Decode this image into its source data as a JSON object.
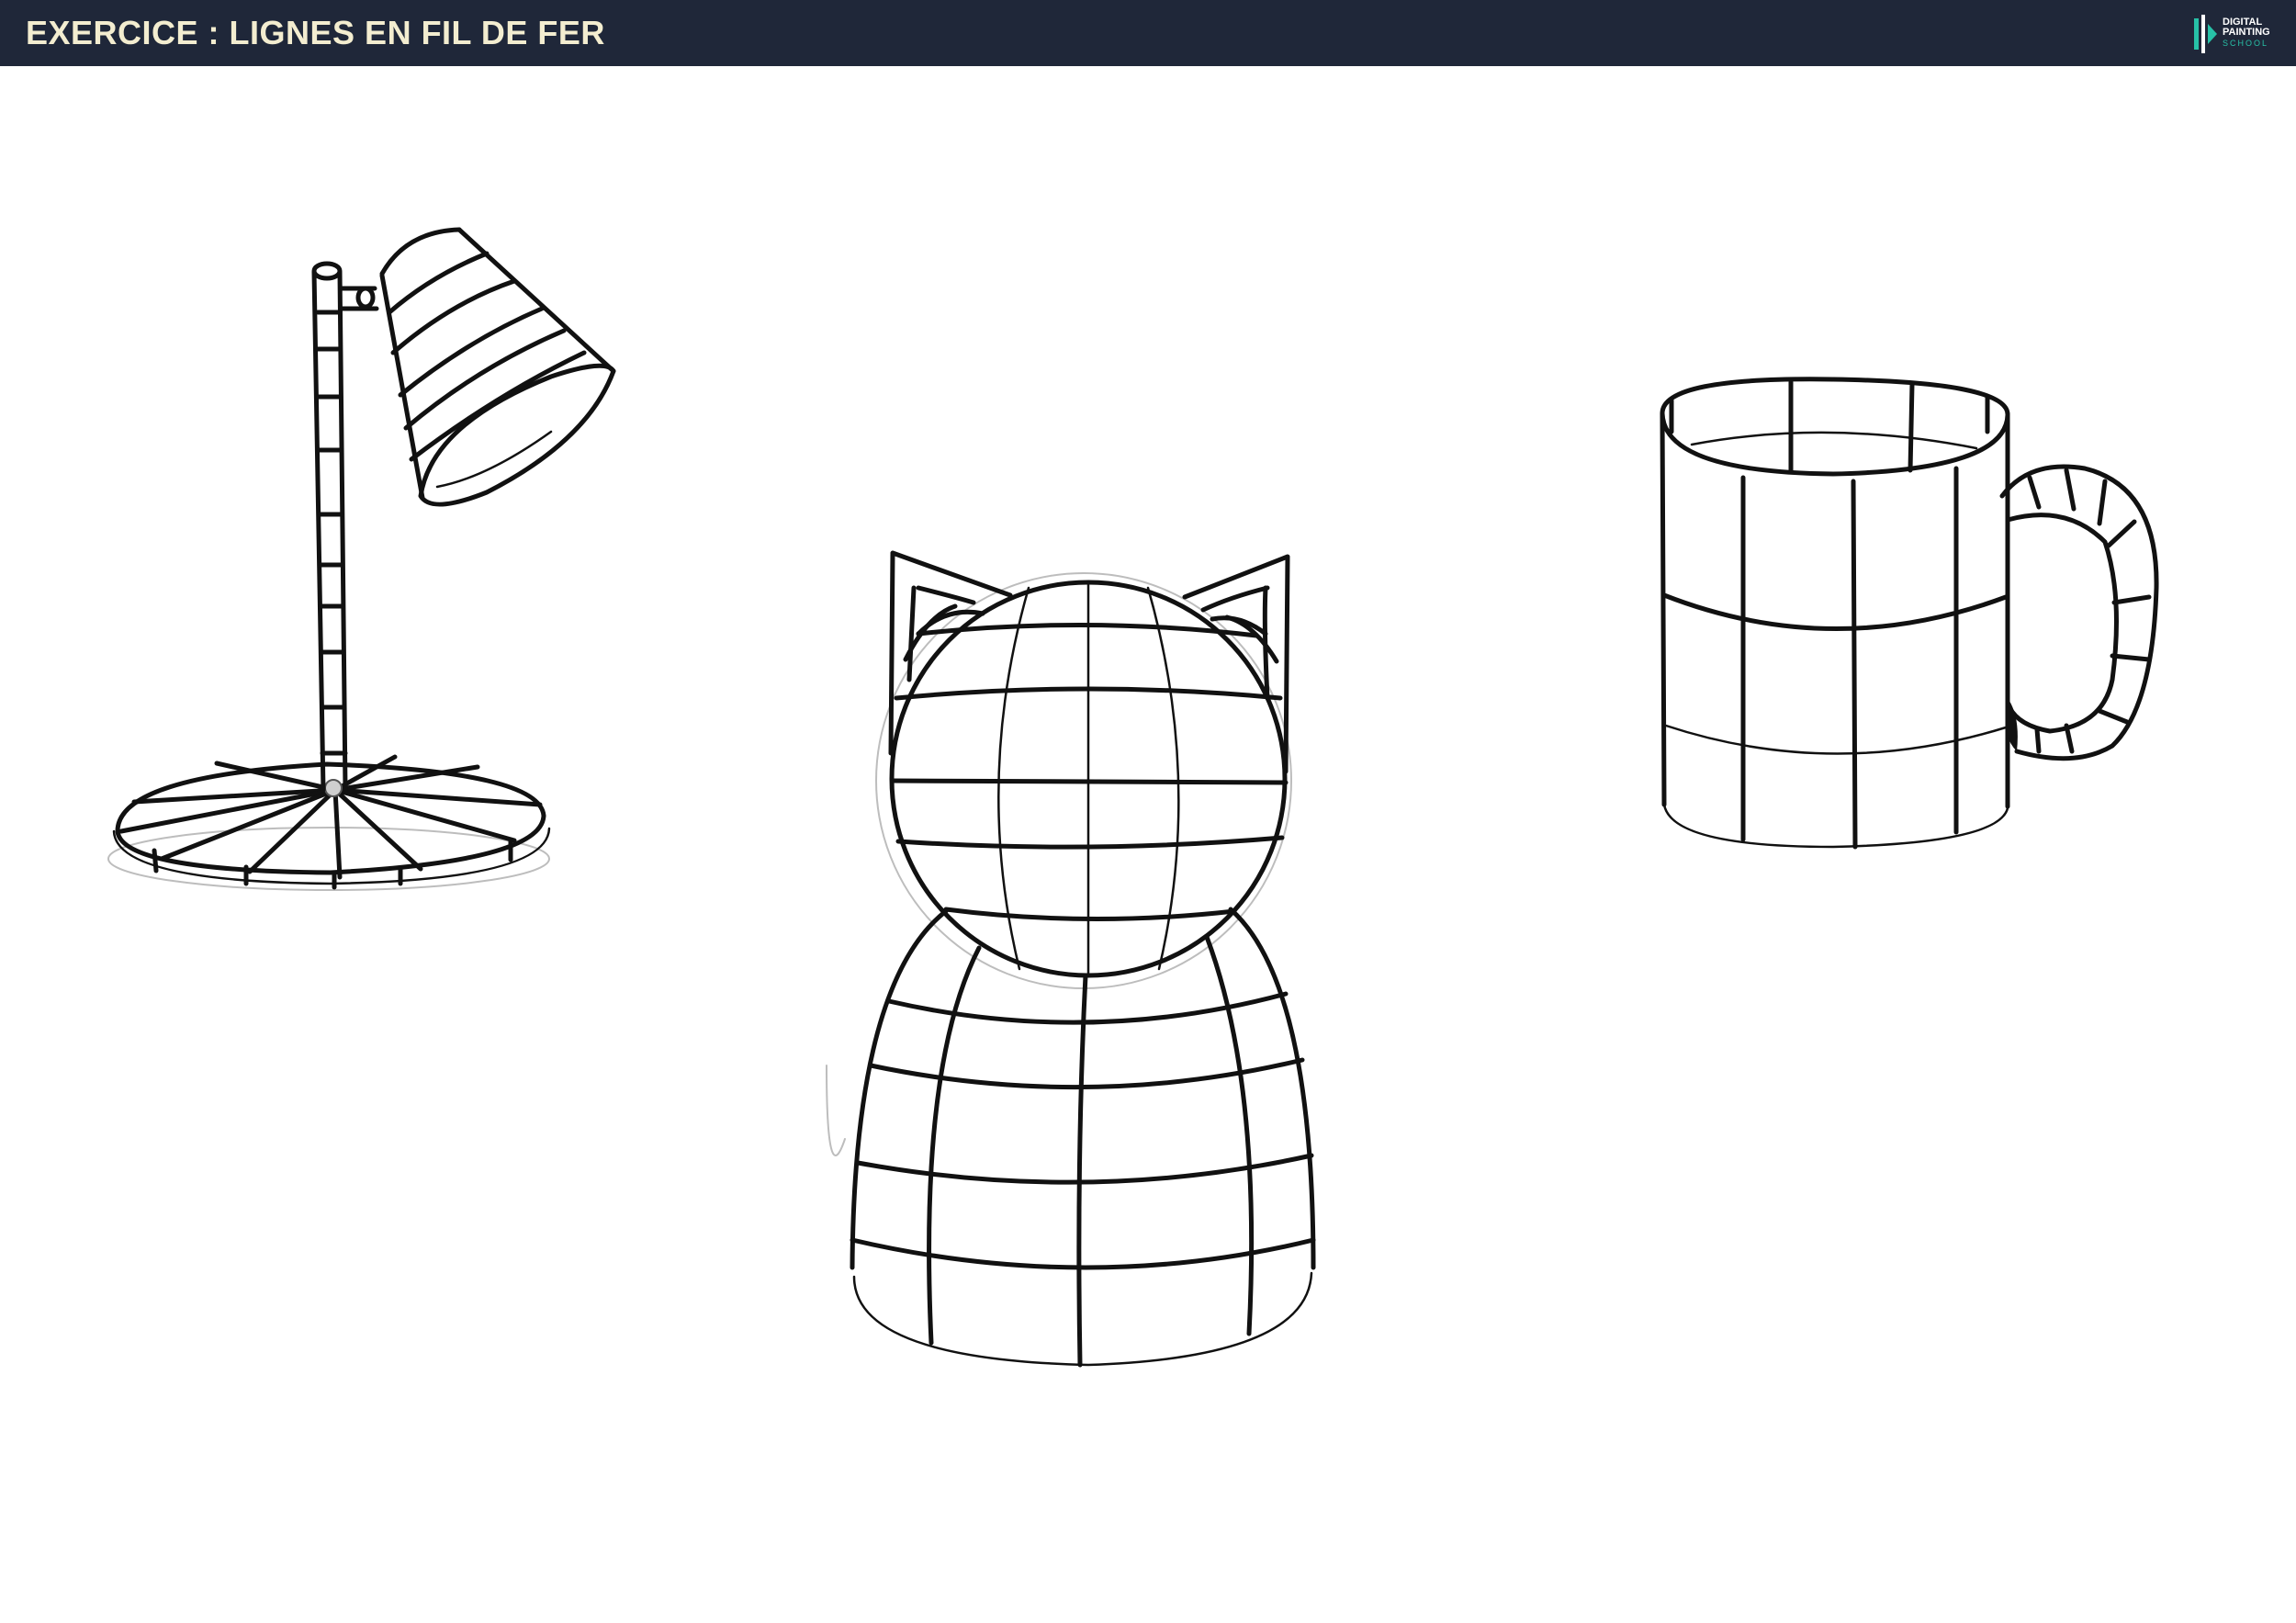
{
  "header": {
    "title": "EXERCICE : LIGNES EN FIL DE FER",
    "logo": {
      "icon": "paintbrush-logo-icon",
      "line1": "DIGITAL",
      "line2": "PAINTING",
      "line3": "SCHOOL"
    },
    "background_color": "#1f2739",
    "title_color": "#f3edd0",
    "accent_color": "#27c1a7"
  },
  "drawings": [
    {
      "name": "desk-lamp",
      "style": "wireframe sketch"
    },
    {
      "name": "cat-figure",
      "style": "wireframe sketch"
    },
    {
      "name": "mug",
      "style": "wireframe sketch"
    }
  ]
}
